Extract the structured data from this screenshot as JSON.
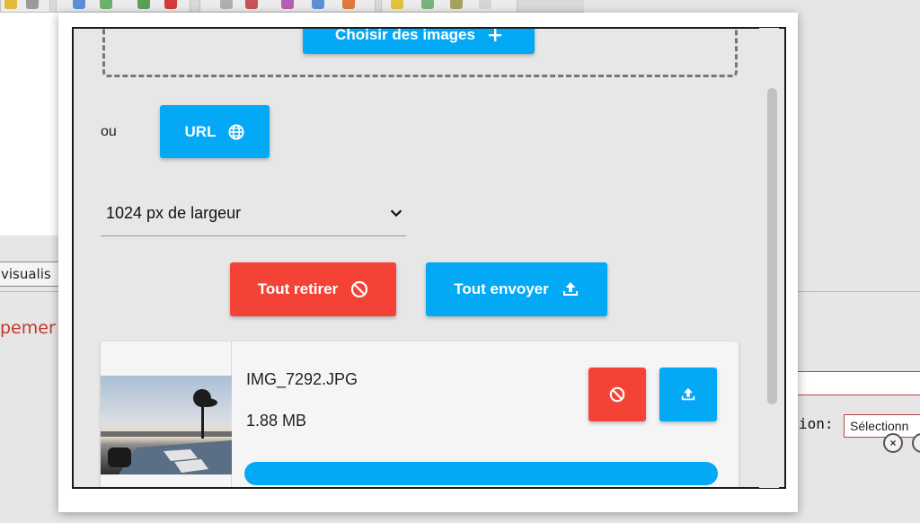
{
  "background": {
    "preview_button_label": "visualis",
    "red_text": "pemer",
    "field_label": "ion:",
    "select_value": "Sélectionn",
    "close_glyph": "×"
  },
  "modal": {
    "choose_images_label": "Choisir des images",
    "or_label": "ou",
    "url_button_label": "URL",
    "size_select_value": "1024 px de largeur",
    "remove_all_label": "Tout retirer",
    "send_all_label": "Tout envoyer",
    "files": [
      {
        "name": "IMG_7292.JPG",
        "size": "1.88 MB",
        "progress": 1.0
      }
    ]
  },
  "colors": {
    "accent_blue": "#03a9f4",
    "danger_red": "#f44336"
  },
  "icons": {
    "url": "globe-icon",
    "remove": "block-icon",
    "send": "upload-icon",
    "select": "chevron-down-icon"
  }
}
